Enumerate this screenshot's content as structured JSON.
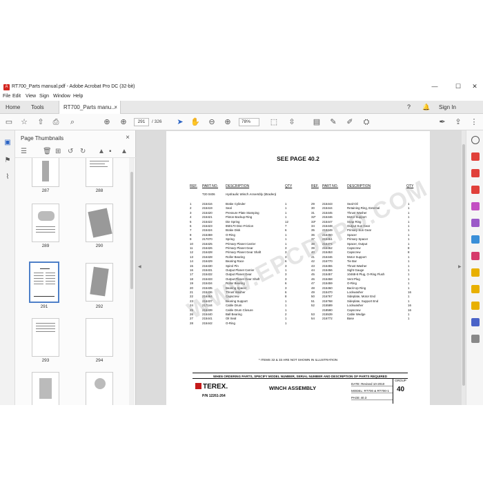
{
  "window": {
    "title": "RT700_Parts manual.pdf - Adobe Acrobat Pro DC (32-bit)",
    "minimize": "—",
    "maximize": "☐",
    "close": "✕"
  },
  "menu": [
    "File",
    "Edit",
    "View",
    "Sign",
    "Window",
    "Help"
  ],
  "tabs": {
    "home": "Home",
    "tools": "Tools",
    "document": "RT700_Parts manu...",
    "document_close": "×",
    "sign_in": "Sign In"
  },
  "toolbar": {
    "current_page": "291",
    "total_pages": "/ 326",
    "zoom": "78%"
  },
  "thumbnails": {
    "title": "Page Thumbnails",
    "close": "×",
    "pages": [
      "287",
      "288",
      "289",
      "290",
      "291",
      "292",
      "293",
      "294"
    ]
  },
  "document": {
    "see_page": "SEE PAGE 40.2",
    "headers": {
      "ref": "REF.",
      "part_no": "PART NO.",
      "description": "DESCRIPTION",
      "qty": "QTY"
    },
    "assembly_part_no": "T20 0406",
    "assembly_desc": "Hydraulic Winch Assembly (Braden)",
    "left_parts": [
      {
        "ref": "1",
        "part": "215416",
        "desc": "Brake Cylinder",
        "qty": "1"
      },
      {
        "ref": "2",
        "part": "215419",
        "desc": "Seal",
        "qty": "1"
      },
      {
        "ref": "3",
        "part": "215420",
        "desc": "Pressure Plate Stamping",
        "qty": "1"
      },
      {
        "ref": "4",
        "part": "215421",
        "desc": "Piston Backup Ring",
        "qty": "1"
      },
      {
        "ref": "5",
        "part": "215422",
        "desc": "Die Spring",
        "qty": "12"
      },
      {
        "ref": "6",
        "part": "215423",
        "desc": "850170 Disc-Friction",
        "qty": "7"
      },
      {
        "ref": "7",
        "part": "215424",
        "desc": "Brake Disk",
        "qty": "6"
      },
      {
        "ref": "8",
        "part": "215459",
        "desc": "O-Ring",
        "qty": "1"
      },
      {
        "ref": "9",
        "part": "217070",
        "desc": "Spring",
        "qty": "1"
      },
      {
        "ref": "10",
        "part": "216425",
        "desc": "Primary Planet Carrier",
        "qty": "1"
      },
      {
        "ref": "11",
        "part": "216426",
        "desc": "Primary Planet Gear",
        "qty": "3"
      },
      {
        "ref": "12",
        "part": "216428",
        "desc": "Primary Planet Gear Shaft",
        "qty": "3"
      },
      {
        "ref": "13",
        "part": "216428",
        "desc": "Roller Bearing",
        "qty": "3"
      },
      {
        "ref": "14",
        "part": "216429",
        "desc": "Bearing Race",
        "qty": "6"
      },
      {
        "ref": "15",
        "part": "216430",
        "desc": "Spirol Pin",
        "qty": "3"
      },
      {
        "ref": "16",
        "part": "215431",
        "desc": "Output Planet Carrier",
        "qty": "1"
      },
      {
        "ref": "17",
        "part": "215432",
        "desc": "Output Planet Gear",
        "qty": "3"
      },
      {
        "ref": "18",
        "part": "215433",
        "desc": "Output Planet Gear Shaft",
        "qty": "3"
      },
      {
        "ref": "19",
        "part": "215434",
        "desc": "Roller Bearing",
        "qty": "6"
      },
      {
        "ref": "20",
        "part": "215435",
        "desc": "Bearing Spacer",
        "qty": "3"
      },
      {
        "ref": "21",
        "part": "215436",
        "desc": "Thrust Washer",
        "qty": "6"
      },
      {
        "ref": "22",
        "part": "216464",
        "desc": "Capscrew",
        "qty": "8"
      },
      {
        "ref": "23",
        "part": "216437",
        "desc": "Bearing Support",
        "qty": "1"
      },
      {
        "ref": "24",
        "part": "217144",
        "desc": "Cable Drum",
        "qty": "1"
      },
      {
        "ref": "25",
        "part": "216439",
        "desc": "Cable Drum Closure",
        "qty": "1"
      },
      {
        "ref": "26",
        "part": "215440",
        "desc": "Ball Bearing",
        "qty": "2"
      },
      {
        "ref": "27",
        "part": "215441",
        "desc": "Oil Seal",
        "qty": "1"
      },
      {
        "ref": "28",
        "part": "215442",
        "desc": "O-Ring",
        "qty": "1"
      }
    ],
    "right_parts": [
      {
        "ref": "29",
        "part": "215443",
        "desc": "Seal-Oil",
        "qty": "1"
      },
      {
        "ref": "30",
        "part": "215444",
        "desc": "Retaining Ring, External",
        "qty": "1"
      },
      {
        "ref": "31",
        "part": "215445",
        "desc": "Thrust Washer",
        "qty": "1"
      },
      {
        "ref": "32*",
        "part": "215446",
        "desc": "Motor Support",
        "qty": "1"
      },
      {
        "ref": "33*",
        "part": "215447",
        "desc": "Snap Ring",
        "qty": "1"
      },
      {
        "ref": "34",
        "part": "215448",
        "desc": "Output Sun Gear",
        "qty": "1"
      },
      {
        "ref": "35",
        "part": "215449",
        "desc": "Primary Sun Gear",
        "qty": "1"
      },
      {
        "ref": "36",
        "part": "215450",
        "desc": "Spacer",
        "qty": "1"
      },
      {
        "ref": "37",
        "part": "215451",
        "desc": "Primary Spacer",
        "qty": "1"
      },
      {
        "ref": "38",
        "part": "215474",
        "desc": "Spacer, Output",
        "qty": "1"
      },
      {
        "ref": "39",
        "part": "215452",
        "desc": "Capscrew",
        "qty": "8"
      },
      {
        "ref": "40",
        "part": "215453",
        "desc": "Capscrew",
        "qty": "8"
      },
      {
        "ref": "41",
        "part": "216446",
        "desc": "Motor Support",
        "qty": "1"
      },
      {
        "ref": "42",
        "part": "216770",
        "desc": "Tie Bar",
        "qty": "1"
      },
      {
        "ref": "43",
        "part": "215455",
        "desc": "Thrust Washer",
        "qty": "1"
      },
      {
        "ref": "44",
        "part": "215456",
        "desc": "Sight Gauge",
        "qty": "1"
      },
      {
        "ref": "45",
        "part": "215457",
        "desc": "10468-8 Plug, O-Ring Flush",
        "qty": "1"
      },
      {
        "ref": "46",
        "part": "215458",
        "desc": "Vent Plug",
        "qty": "1"
      },
      {
        "ref": "47",
        "part": "215459",
        "desc": "O-Ring",
        "qty": "1"
      },
      {
        "ref": "48",
        "part": "215460",
        "desc": "Back-Up Ring",
        "qty": "1"
      },
      {
        "ref": "49",
        "part": "215470",
        "desc": "Lockwasher",
        "qty": "16"
      },
      {
        "ref": "50",
        "part": "216767",
        "desc": "Sideplate, Motor End",
        "qty": "1"
      },
      {
        "ref": "51",
        "part": "216768",
        "desc": "Sideplate, Support End",
        "qty": "1"
      },
      {
        "ref": "52",
        "part": "215589",
        "desc": "Lockwasher",
        "qty": "16"
      },
      {
        "ref": "",
        "part": "218590",
        "desc": "Capscrew",
        "qty": "16"
      },
      {
        "ref": "53",
        "part": "215539",
        "desc": "Cable Wedge",
        "qty": "1"
      },
      {
        "ref": "54",
        "part": "216772",
        "desc": "Base",
        "qty": "1"
      }
    ],
    "note": "* ITEMS 32 & 33 ARE NOT SHOWN IN ILLUSTRATION",
    "order_note": "WHEN ORDERING PARTS, SPECIFY MODEL NUMBER, SERIAL NUMBER AND DESCRIPTION OF PARTS REQUIRED",
    "brand": "TEREX.",
    "pn": "P/N 12261-264",
    "assembly_title": "WINCH ASSEMBLY",
    "date_label": "DATE:",
    "date_value": "Revised 10-2010",
    "model_label": "MODEL:",
    "model_value": "RT700 & RT700-1",
    "page_label": "PAGE",
    "page_value": "40.3",
    "group_label": "GROUP",
    "group_value": "40"
  },
  "watermark": "WWW.EPCDEPO.COM"
}
